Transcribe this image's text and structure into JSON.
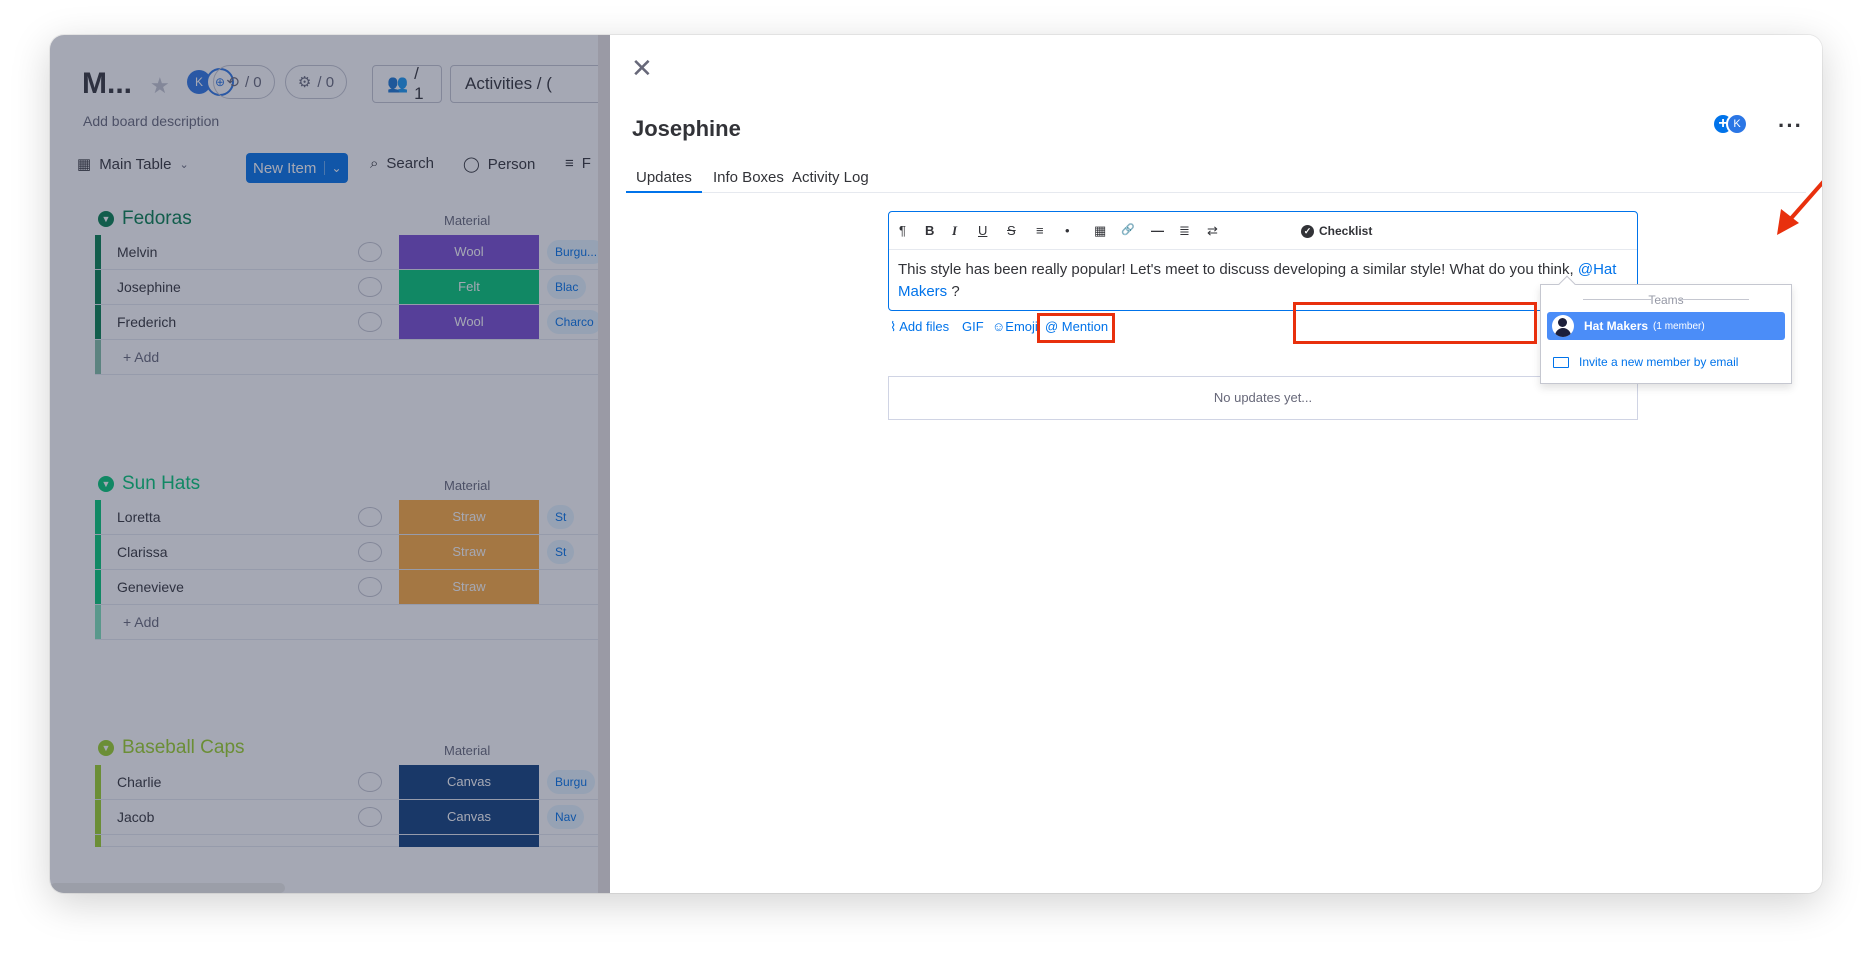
{
  "board": {
    "title": "M...",
    "description": "Add board description",
    "avatar_initial": "K",
    "automations_count": "/ 0",
    "integrations_count": "/ 0",
    "members_count": "/ 1",
    "activities_label": "Activities / (",
    "toolbar": {
      "view_label": "Main Table",
      "new_item_label": "New Item",
      "search_label": "Search",
      "person_label": "Person",
      "filter_label": "F"
    },
    "groups": [
      {
        "title": "Fedoras",
        "color": "#037f4c",
        "column_header": "Material",
        "rows": [
          {
            "name": "Melvin",
            "material": "Wool",
            "material_color": "#784bd1",
            "col3": "Burgu..."
          },
          {
            "name": "Josephine",
            "material": "Felt",
            "material_color": "#00c875",
            "col3": "Blac"
          },
          {
            "name": "Frederich",
            "material": "Wool",
            "material_color": "#784bd1",
            "col3": "Charco"
          }
        ],
        "add_label": "+ Add"
      },
      {
        "title": "Sun Hats",
        "color": "#00c875",
        "column_header": "Material",
        "rows": [
          {
            "name": "Loretta",
            "material": "Straw",
            "material_color": "#fdab3d",
            "col3": "St"
          },
          {
            "name": "Clarissa",
            "material": "Straw",
            "material_color": "#fdab3d",
            "col3": "St"
          },
          {
            "name": "Genevieve",
            "material": "Straw",
            "material_color": "#fdab3d",
            "col3": ""
          }
        ],
        "add_label": "+ Add"
      },
      {
        "title": "Baseball Caps",
        "color": "#9cd326",
        "column_header": "Material",
        "rows": [
          {
            "name": "Charlie",
            "material": "Canvas",
            "material_color": "#0f3f7c",
            "col3": "Burgu"
          },
          {
            "name": "Jacob",
            "material": "Canvas",
            "material_color": "#0f3f7c",
            "col3": "Nav"
          }
        ]
      }
    ]
  },
  "panel": {
    "item_title": "Josephine",
    "subscriber_initial": "K",
    "tabs": [
      "Updates",
      "Info Boxes",
      "Activity Log"
    ],
    "editor": {
      "toolbar": [
        "¶",
        "B",
        "I",
        "U",
        "S",
        "≡",
        "•",
        "▦",
        "🔗",
        "—",
        "≣",
        "⇄"
      ],
      "checklist_label": "Checklist",
      "text_before": "This style has been really popular! Let's meet to discuss developing a similar style! What do you think, ",
      "mention": "@Hat Makers",
      "text_after": " ?"
    },
    "actions": {
      "add_files": "Add files",
      "gif": "GIF",
      "emoji": "Emoji",
      "mention": "@ Mention"
    },
    "empty_state": "No updates yet...",
    "mention_dropdown": {
      "section_label": "Teams",
      "team_name": "Hat Makers",
      "team_count": "(1 member)",
      "invite_label": "Invite a new member by email"
    }
  },
  "colors": {
    "accent": "#0073ea",
    "highlight": "#e8300d"
  }
}
